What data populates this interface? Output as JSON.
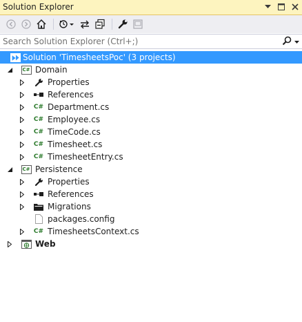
{
  "window": {
    "title": "Solution Explorer",
    "buttons": [
      "pin-dropdown",
      "restore",
      "close"
    ]
  },
  "toolbar": {
    "items": [
      "back-icon",
      "forward-icon",
      "home-icon",
      "pending-changes-icon",
      "sync-icon",
      "collapse-all-icon",
      "properties-icon",
      "preview-icon"
    ]
  },
  "search": {
    "placeholder": "Search Solution Explorer (Ctrl+;)",
    "value": ""
  },
  "colors": {
    "title_bg": "#fdf4bf",
    "toolbar_bg": "#eeeef2",
    "selection": "#3399ff",
    "cs_green": "#2b7a2b"
  },
  "tree": {
    "solution": "Solution 'TimesheetsPoc' (3 projects)",
    "domain": {
      "name": "Domain",
      "properties": "Properties",
      "references": "References",
      "files": [
        "Department.cs",
        "Employee.cs",
        "TimeCode.cs",
        "Timesheet.cs",
        "TimesheetEntry.cs"
      ]
    },
    "persistence": {
      "name": "Persistence",
      "properties": "Properties",
      "references": "References",
      "migrations": "Migrations",
      "packages": "packages.config",
      "context": "TimesheetsContext.cs"
    },
    "web": {
      "name": "Web"
    }
  }
}
